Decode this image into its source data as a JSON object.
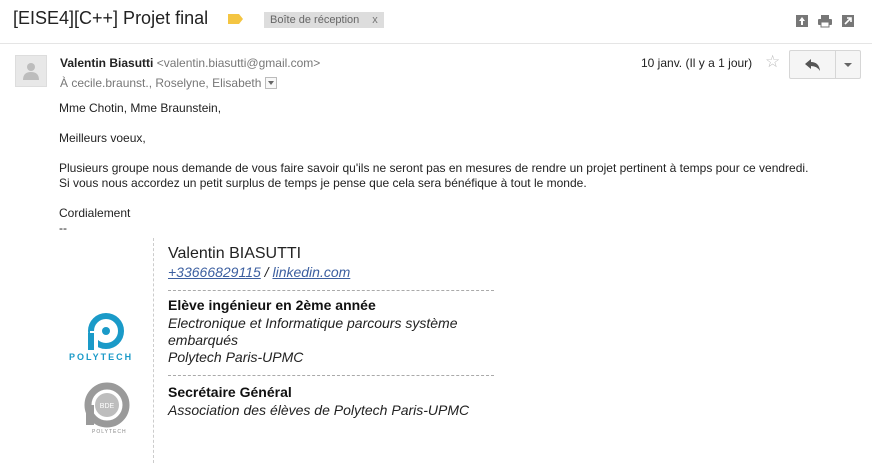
{
  "subject": {
    "title": "[EISE4][C++] Projet final",
    "label_color": "#f4c542",
    "inbox_chip": {
      "label": "Boîte de réception",
      "close": "x"
    }
  },
  "toolbar_icons": [
    "expand-icon",
    "print-icon",
    "new-window-icon"
  ],
  "sender": {
    "name": "Valentin Biasutti",
    "email": "<valentin.biasutti@gmail.com>",
    "recipients": "À cecile.braunst., Roselyne, Elisabeth",
    "date": "10 janv. (Il y a 1 jour)",
    "star": "☆"
  },
  "body": {
    "greeting": "Mme Chotin, Mme Braunstein,",
    "wishes": "Meilleurs voeux,",
    "paragraph": "Plusieurs groupe nous demande de vous faire savoir qu'ils ne seront pas en mesures de rendre un projet pertinent à temps pour ce vendredi. Si vous nous accordez un petit surplus de temps je pense que cela sera bénéfique à tout le monde.",
    "closing": "Cordialement",
    "separator": "--"
  },
  "signature": {
    "name": "Valentin BIASUTTI",
    "phone": "+33666829115",
    "slash": " / ",
    "linkedin": "linkedin.com",
    "role1": "Elève ingénieur en 2ème année",
    "program": "Electronique et Informatique parcours système embarqués",
    "school": "Polytech Paris-UPMC",
    "role2": "Secrétaire Général",
    "association": "Association des élèves de Polytech Paris-UPMC",
    "logo1_text": "POLYTECH",
    "logo2_text": "BDE",
    "logo2_sub": "POLYTECH"
  },
  "colors": {
    "link": "#3c5fa0",
    "polytech_blue": "#1a9ac8",
    "bde_grey": "#9a9a9a"
  }
}
